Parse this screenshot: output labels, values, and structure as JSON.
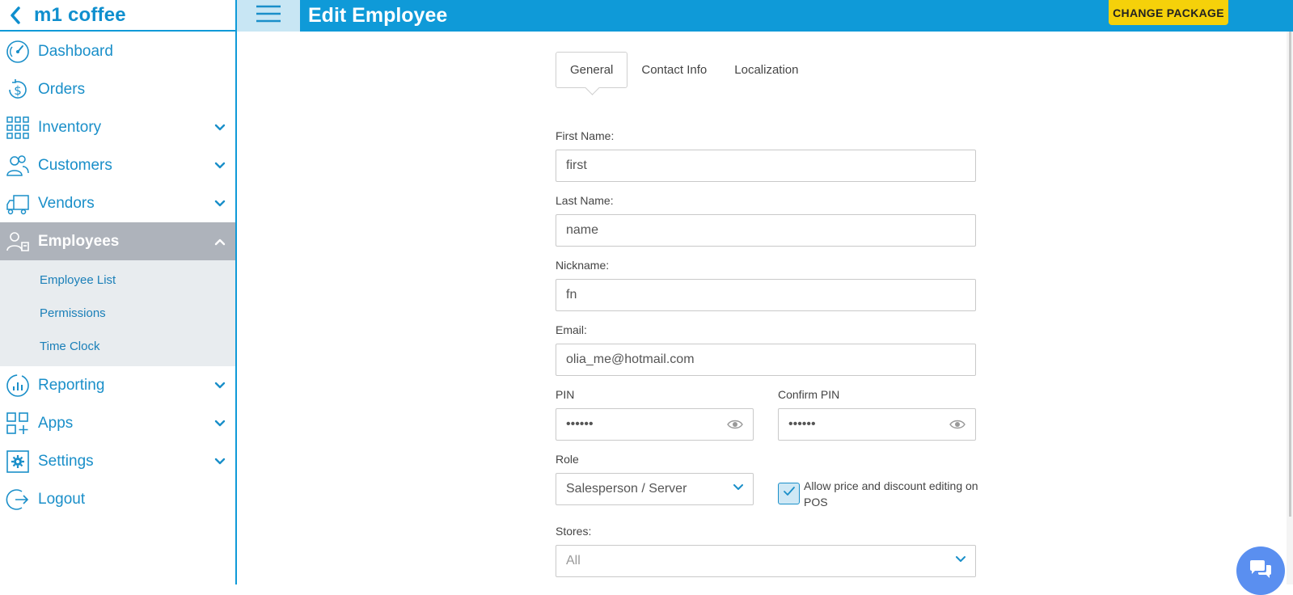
{
  "sidebar": {
    "brand": "m1 coffee",
    "items": [
      {
        "label": "Dashboard"
      },
      {
        "label": "Orders"
      },
      {
        "label": "Inventory"
      },
      {
        "label": "Customers"
      },
      {
        "label": "Vendors"
      },
      {
        "label": "Employees"
      },
      {
        "label": "Reporting"
      },
      {
        "label": "Apps"
      },
      {
        "label": "Settings"
      },
      {
        "label": "Logout"
      }
    ],
    "employees_sub": [
      {
        "label": "Employee List"
      },
      {
        "label": "Permissions"
      },
      {
        "label": "Time Clock"
      }
    ]
  },
  "header": {
    "title": "Edit Employee",
    "change_package": "CHANGE PACKAGE"
  },
  "tabs": [
    {
      "label": "General"
    },
    {
      "label": "Contact Info"
    },
    {
      "label": "Localization"
    }
  ],
  "form": {
    "first_name": {
      "label": "First Name:",
      "value": "first"
    },
    "last_name": {
      "label": "Last Name:",
      "value": "name"
    },
    "nickname": {
      "label": "Nickname:",
      "value": "fn"
    },
    "email": {
      "label": "Email:",
      "value": "olia_me@hotmail.com"
    },
    "pin": {
      "label": "PIN",
      "value": "••••••"
    },
    "confirm_pin": {
      "label": "Confirm PIN",
      "value": "••••••"
    },
    "role": {
      "label": "Role",
      "value": "Salesperson / Server"
    },
    "allow_price_edit": {
      "label": "Allow price and discount editing on POS",
      "checked": true
    },
    "stores": {
      "label": "Stores:",
      "value": "All"
    }
  },
  "colors": {
    "accent": "#0f9ad8",
    "active_nav": "#aeb3bb",
    "package_btn": "#f5d10a"
  }
}
